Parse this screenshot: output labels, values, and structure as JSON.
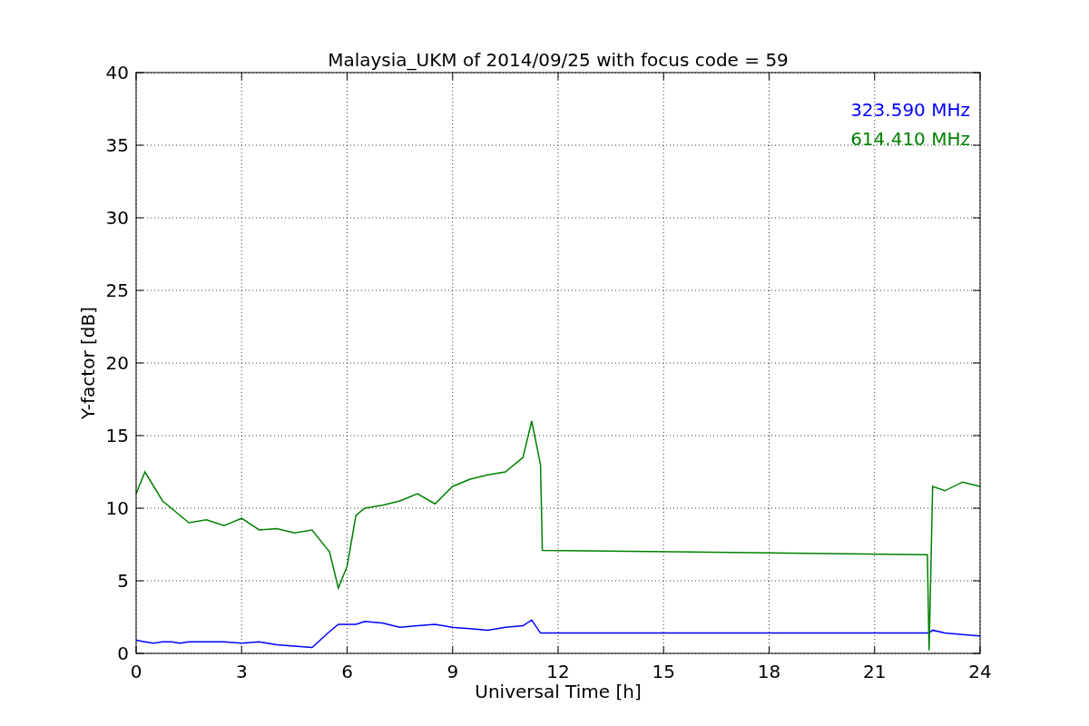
{
  "chart_data": {
    "type": "line",
    "title": "Malaysia_UKM of 2014/09/25 with focus code = 59",
    "xlabel": "Universal Time [h]",
    "ylabel": "Y-factor [dB]",
    "x": [
      0,
      0.25,
      0.5,
      0.75,
      1,
      1.25,
      1.5,
      2,
      2.5,
      3,
      3.5,
      4,
      4.5,
      5,
      5.5,
      5.75,
      6,
      6.25,
      6.5,
      7,
      7.5,
      8,
      8.5,
      9,
      9.5,
      10,
      10.5,
      11,
      11.25,
      11.5,
      11.55,
      22.5,
      22.55,
      22.65,
      23,
      23.5,
      24
    ],
    "series": [
      {
        "name": "323.590 MHz",
        "color": "#0000ff",
        "values": [
          0.9,
          0.8,
          0.7,
          0.8,
          0.8,
          0.7,
          0.8,
          0.8,
          0.8,
          0.7,
          0.8,
          0.6,
          0.5,
          0.4,
          1.5,
          2,
          2,
          2,
          2.2,
          2.1,
          1.8,
          1.9,
          2,
          1.8,
          1.7,
          1.6,
          1.8,
          1.9,
          2.3,
          1.4,
          1.4,
          1.4,
          1.4,
          1.6,
          1.4,
          1.3,
          1.2
        ]
      },
      {
        "name": "614.410 MHz",
        "color": "#008000",
        "values": [
          11,
          12.5,
          11.5,
          10.5,
          10,
          9.5,
          9,
          9.2,
          8.8,
          9.3,
          8.5,
          8.6,
          8.3,
          8.5,
          7,
          4.5,
          6,
          9.5,
          10,
          10.2,
          10.5,
          11,
          10.3,
          11.5,
          12,
          12.3,
          12.5,
          13.5,
          16,
          13,
          7.1,
          6.8,
          0.2,
          11.5,
          11.2,
          11.8,
          11.5
        ]
      }
    ],
    "grid": true,
    "xlim": [
      0,
      24
    ],
    "ylim": [
      0,
      40
    ],
    "xticks": [
      0,
      3,
      6,
      9,
      12,
      15,
      18,
      21,
      24
    ],
    "yticks": [
      0,
      5,
      10,
      15,
      20,
      25,
      30,
      35,
      40
    ]
  }
}
